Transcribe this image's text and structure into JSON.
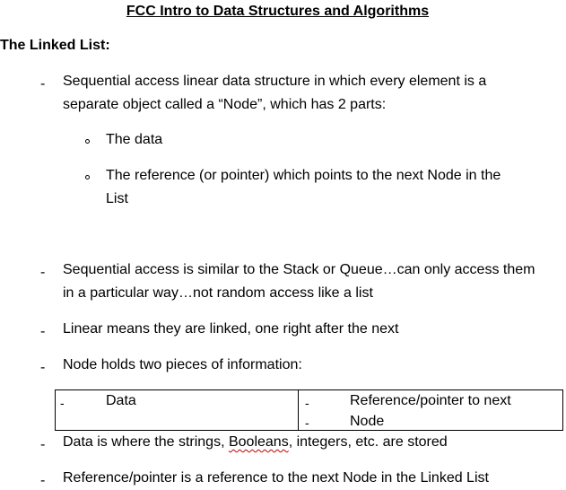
{
  "document": {
    "title": "FCC Intro to Data Structures and Algorithms",
    "section_heading": "The Linked List:",
    "bullet_marker": "-",
    "sub_bullet_marker": "o",
    "points": [
      {
        "lines": [
          "Sequential access linear data structure in which every element is a",
          "separate object called a “Node”, which has 2 parts:"
        ]
      },
      {
        "lines": [
          "Sequential access is similar to the Stack or Queue…can only access them",
          "in a particular way…not random access like a list"
        ]
      },
      {
        "lines": [
          "Linear means they are linked, one right after the next"
        ]
      },
      {
        "lines": [
          "Node holds two pieces of information:"
        ]
      },
      {
        "parts": [
          "Data is where the strings, ",
          "Booleans",
          ", integers, etc. are stored"
        ]
      },
      {
        "lines": [
          "Reference/pointer is a reference to the next Node in the Linked List"
        ]
      }
    ],
    "sub_points": [
      {
        "lines": [
          "The data"
        ]
      },
      {
        "lines": [
          "The reference (or pointer) which points to the next Node in the",
          "List"
        ]
      }
    ],
    "table": {
      "cell1": "Data",
      "cell2_lines": [
        "Reference/pointer to next",
        "Node"
      ]
    }
  }
}
